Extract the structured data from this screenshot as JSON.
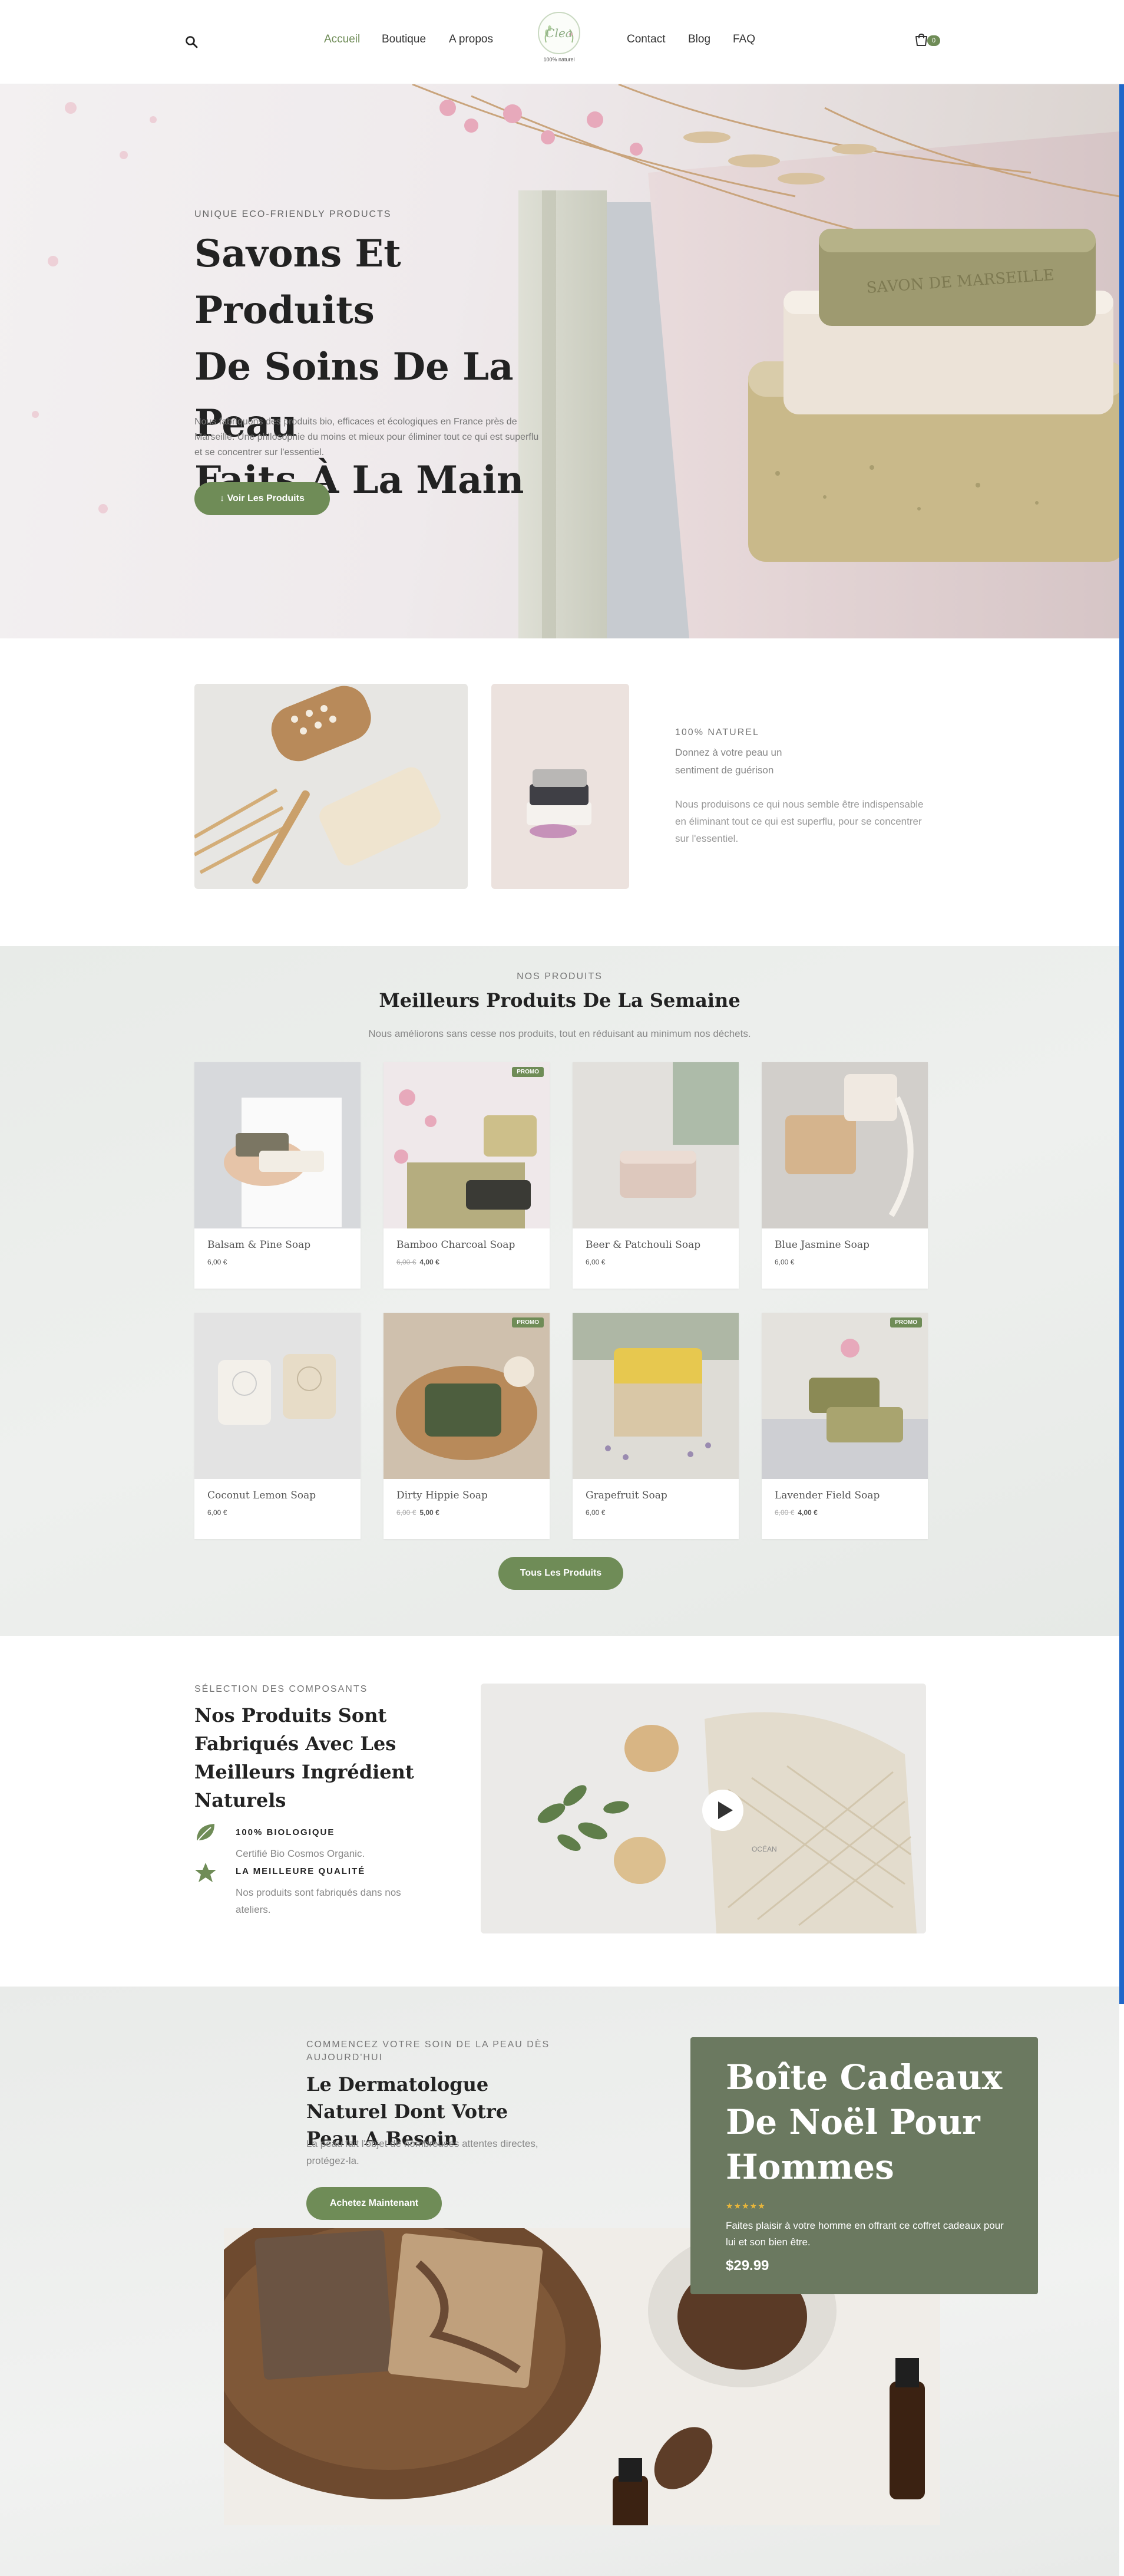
{
  "header": {
    "nav_left": [
      "Accueil",
      "Boutique",
      "A propos"
    ],
    "nav_right": [
      "Contact",
      "Blog",
      "FAQ"
    ],
    "logo_text": "Clea",
    "logo_subtext": "100% naturel",
    "cart_count": "0",
    "active_color": "#6f8c57"
  },
  "hero": {
    "eyebrow": "UNIQUE ECO-FRIENDLY PRODUCTS",
    "title_lines": [
      "Savons Et Produits",
      "De Soins De La Peau",
      "Faits À La Main"
    ],
    "text": "Nous fabriquons des produits bio, efficaces et écologiques en France près de Marseille. Une philosophie du moins et mieux pour éliminer tout ce qui est superflu et se concentrer sur l'essentiel.",
    "button": "↓ Voir Les Produits",
    "soap_stamp": "SAVON DE MARSEILLE"
  },
  "intro": {
    "eyebrow": "100% NATUREL",
    "title": "Donnez à votre peau un sentiment de guérison",
    "text": "Nous produisons ce qui nous semble être indispensable en éliminant tout ce qui est superflu, pour se concentrer sur l'essentiel."
  },
  "products": {
    "eyebrow": "NOS PRODUITS",
    "title": "Meilleurs Produits De La Semaine",
    "subtitle": "Nous améliorons sans cesse nos produits, tout en réduisant au minimum nos déchets.",
    "promo_label": "PROMO",
    "items": [
      {
        "name": "Balsam & Pine Soap",
        "price": "6,00 €",
        "old_price": ""
      },
      {
        "name": "Bamboo Charcoal Soap",
        "price": "4,00 €",
        "old_price": "6,00 €"
      },
      {
        "name": "Beer & Patchouli Soap",
        "price": "6,00 €",
        "old_price": ""
      },
      {
        "name": "Blue Jasmine Soap",
        "price": "6,00 €",
        "old_price": ""
      },
      {
        "name": "Coconut Lemon Soap",
        "price": "6,00 €",
        "old_price": ""
      },
      {
        "name": "Dirty Hippie Soap",
        "price": "5,00 €",
        "old_price": "6,00 €"
      },
      {
        "name": "Grapefruit Soap",
        "price": "6,00 €",
        "old_price": ""
      },
      {
        "name": "Lavender Field Soap",
        "price": "4,00 €",
        "old_price": "6,00 €"
      }
    ],
    "all_button": "Tous Les Produits"
  },
  "ingredients": {
    "eyebrow": "SÉLECTION DES COMPOSANTS",
    "title": "Nos Produits Sont Fabriqués Avec Les Meilleurs Ingrédient Naturels",
    "features": [
      {
        "icon": "leaf-icon",
        "title": "100% BIOLOGIQUE",
        "text": "Certifié Bio Cosmos Organic."
      },
      {
        "icon": "star-icon",
        "title": "LA MEILLEURE QUALITÉ",
        "text": "Nos produits sont fabriqués dans nos ateliers."
      }
    ],
    "video_label": "OCÉAN"
  },
  "cta": {
    "eyebrow": "COMMENCEZ VOTRE SOIN DE LA PEAU DÈS AUJOURD'HUI",
    "title": "Le Dermatologue Naturel Dont Votre Peau A Besoin",
    "text": "La peau fait l'objet de nombreuses attentes directes, protégez-la.",
    "button": "Achetez Maintenant"
  },
  "gift": {
    "title": "Boîte Cadeaux De Noël Pour Hommes",
    "stars": "★★★★★",
    "text": "Faites plaisir à votre homme en offrant ce coffret cadeaux pour lui et son bien être.",
    "price": "$29.99",
    "bg_color": "#6b7960"
  }
}
